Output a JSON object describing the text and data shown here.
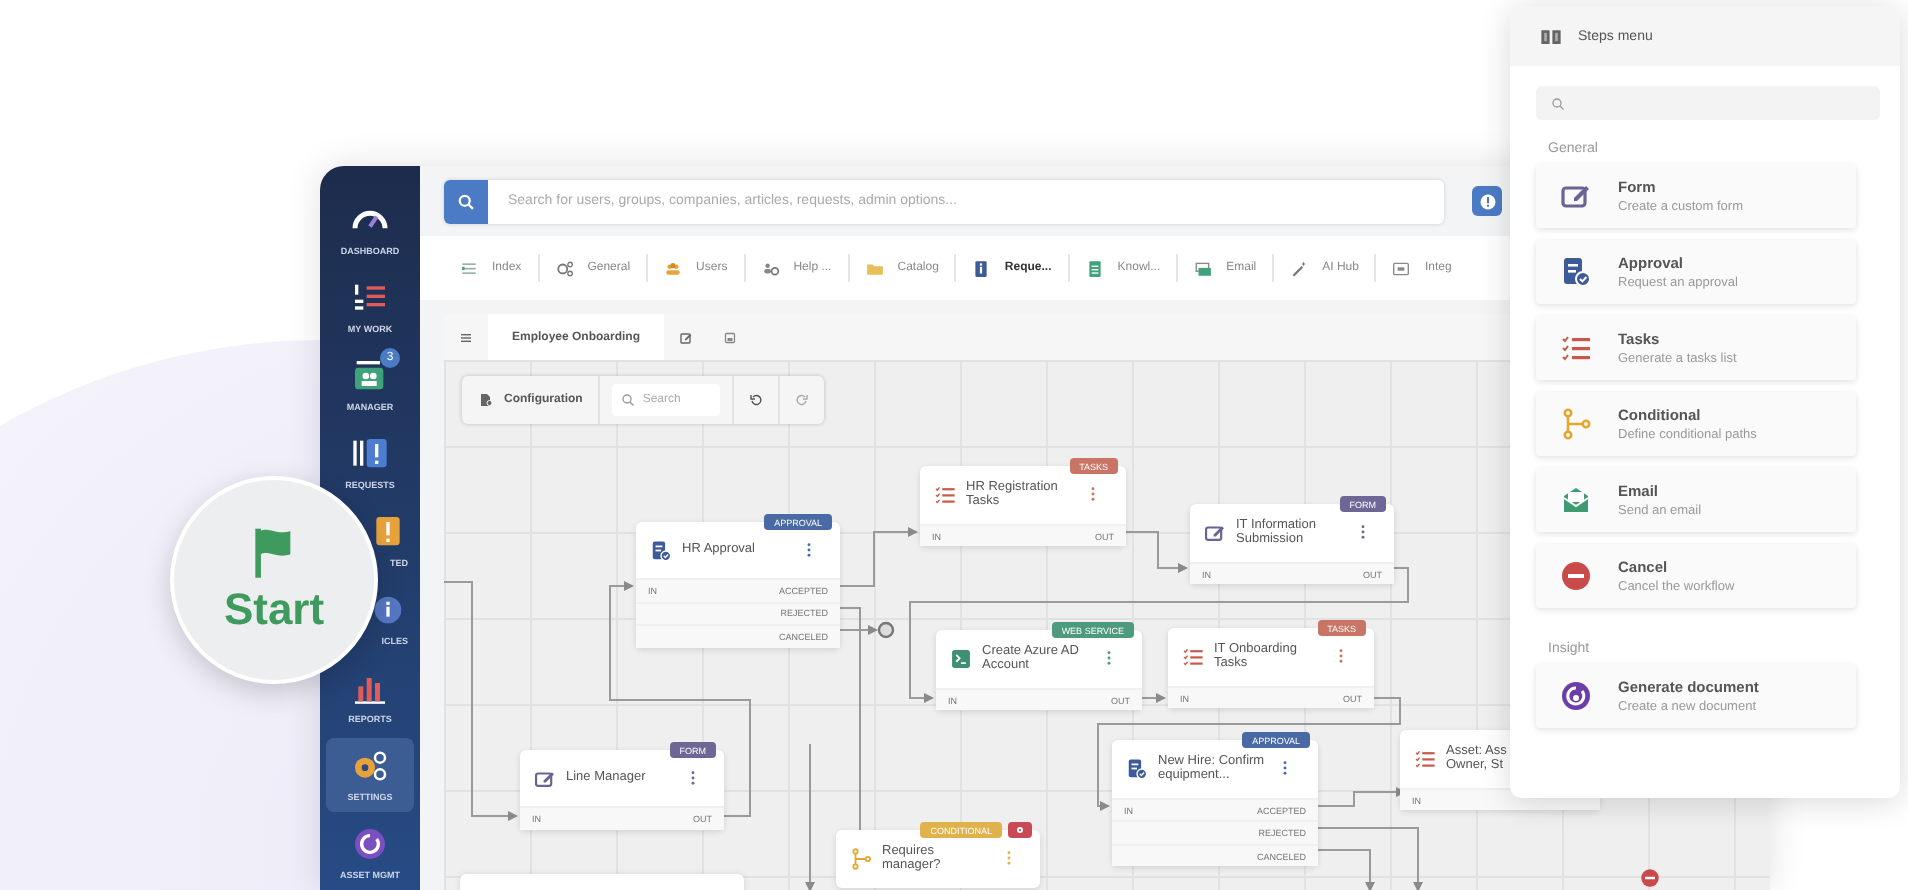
{
  "sidebar": {
    "items": [
      {
        "label": "DASHBOARD",
        "selected": false
      },
      {
        "label": "MY WORK",
        "selected": false
      },
      {
        "label": "MANAGER",
        "selected": false,
        "badge": "3"
      },
      {
        "label": "REQUESTS",
        "selected": false
      },
      {
        "label": "TED",
        "selected": false
      },
      {
        "label": "ICLES",
        "selected": false
      },
      {
        "label": "REPORTS",
        "selected": false
      },
      {
        "label": "SETTINGS",
        "selected": true
      },
      {
        "label": "ASSET MGMT",
        "selected": false
      }
    ]
  },
  "search": {
    "placeholder": "Search for users, groups, companies, articles, requests, admin options..."
  },
  "nav_tabs": [
    {
      "label": "Index",
      "selected": false
    },
    {
      "label": "General",
      "selected": false
    },
    {
      "label": "Users",
      "selected": false
    },
    {
      "label": "Help ...",
      "selected": false
    },
    {
      "label": "Catalog",
      "selected": false
    },
    {
      "label": "Reque...",
      "selected": true
    },
    {
      "label": "Knowl...",
      "selected": false
    },
    {
      "label": "Email",
      "selected": false
    },
    {
      "label": "AI Hub",
      "selected": false
    },
    {
      "label": "Integ",
      "selected": false
    }
  ],
  "editor_tabs": [
    {
      "label": "Employee Onboarding",
      "selected": true
    }
  ],
  "toolbar": {
    "configuration": "Configuration",
    "search_placeholder": "Search"
  },
  "start": {
    "label": "Start"
  },
  "nodes": [
    {
      "kind": "approval",
      "tag": "APPROVAL",
      "title": "HR Approval",
      "inputs": [
        "IN"
      ],
      "outputs": [
        "ACCEPTED",
        "REJECTED",
        "CANCELED"
      ]
    },
    {
      "kind": "form",
      "tag": "FORM",
      "title": "Line Manager",
      "inputs": [
        "IN"
      ],
      "outputs": [
        "OUT"
      ]
    },
    {
      "kind": "tasks",
      "tag": "TASKS",
      "title": "HR Registration Tasks",
      "inputs": [
        "IN"
      ],
      "outputs": [
        "OUT"
      ]
    },
    {
      "kind": "form",
      "tag": "FORM",
      "title": "IT Information Submission",
      "inputs": [
        "IN"
      ],
      "outputs": [
        "OUT"
      ]
    },
    {
      "kind": "web_service",
      "tag": "WEB SERVICE",
      "title": "Create Azure AD Account",
      "inputs": [
        "IN"
      ],
      "outputs": [
        "OUT"
      ]
    },
    {
      "kind": "tasks",
      "tag": "TASKS",
      "title": "IT Onboarding Tasks",
      "inputs": [
        "IN"
      ],
      "outputs": [
        "OUT"
      ]
    },
    {
      "kind": "approval",
      "tag": "APPROVAL",
      "title": "New Hire: Confirm equipment...",
      "inputs": [
        "IN"
      ],
      "outputs": [
        "ACCEPTED",
        "REJECTED",
        "CANCELED"
      ]
    },
    {
      "kind": "tasks",
      "title": "Asset: Ass Owner, St",
      "inputs": [
        "IN"
      ]
    },
    {
      "kind": "conditional",
      "tag": "CONDITIONAL",
      "alert": true,
      "title": "Requires manager?"
    }
  ],
  "steps_menu": {
    "title": "Steps menu",
    "sections": [
      {
        "heading": "General",
        "items": [
          {
            "kind": "form",
            "title": "Form",
            "description": "Create a custom form"
          },
          {
            "kind": "approval",
            "title": "Approval",
            "description": "Request an approval"
          },
          {
            "kind": "tasks",
            "title": "Tasks",
            "description": "Generate a tasks list"
          },
          {
            "kind": "conditional",
            "title": "Conditional",
            "description": "Define conditional paths"
          },
          {
            "kind": "email",
            "title": "Email",
            "description": "Send an email"
          },
          {
            "kind": "cancel",
            "title": "Cancel",
            "description": "Cancel the workflow"
          }
        ]
      },
      {
        "heading": "Insight",
        "items": [
          {
            "kind": "document",
            "title": "Generate document",
            "description": "Create a new document"
          }
        ]
      }
    ]
  }
}
